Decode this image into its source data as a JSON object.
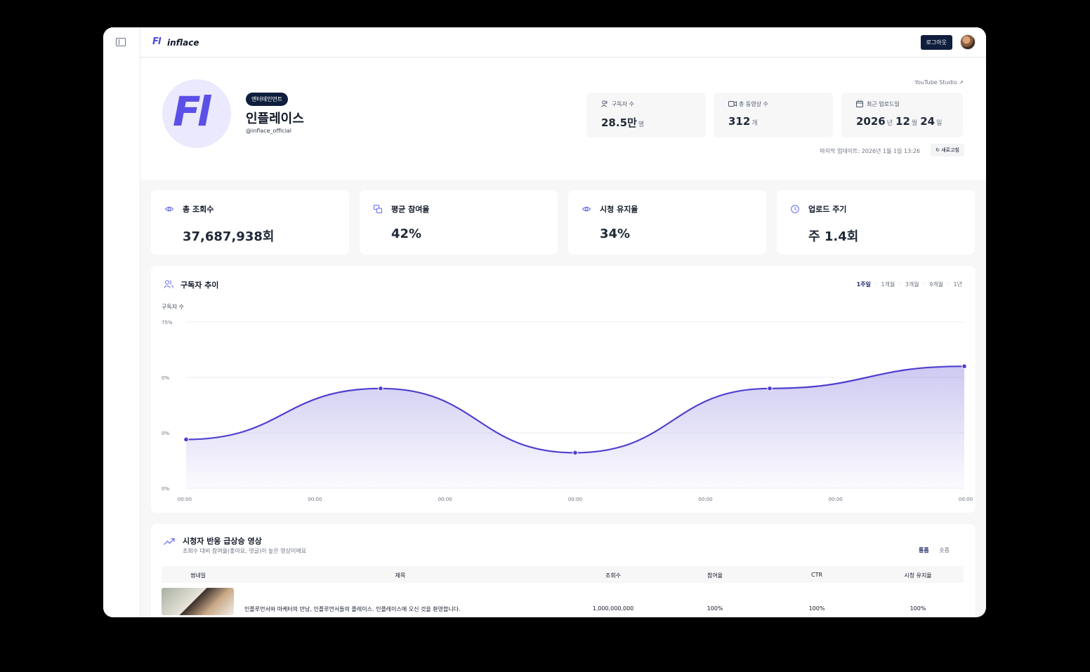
{
  "header": {
    "logo_mark": "Fl",
    "logo_text": "inflace",
    "logout_label": "로그아웃"
  },
  "profile": {
    "logo_mark": "Fl",
    "category": "엔터테인먼트",
    "name": "인플레이스",
    "handle": "@inflace_official",
    "studio_link": "YouTube Studio ↗",
    "stats": {
      "subscribers_label": "구독자 수",
      "subscribers_value": "28.5만",
      "subscribers_unit": "명",
      "videos_label": "총 동영상 수",
      "videos_value": "312",
      "videos_unit": "개",
      "upload_label": "최근 업로드일",
      "upload_year": "2026",
      "upload_year_unit": "년",
      "upload_month": "12",
      "upload_month_unit": "월",
      "upload_day": "24",
      "upload_day_unit": "일"
    },
    "updated_text": "마지막 업데이트: 2026년 1월 1일 13:26",
    "refresh_label": "↻ 새로고침"
  },
  "metrics": [
    {
      "label": "총 조회수",
      "value": "37,687,938회",
      "icon": "eye-icon"
    },
    {
      "label": "평균 참여율",
      "value": "42%",
      "icon": "engagement-icon"
    },
    {
      "label": "시청 유지율",
      "value": "34%",
      "icon": "eye-icon"
    },
    {
      "label": "업로드 주기",
      "value": "주 1.4회",
      "icon": "clock-icon"
    }
  ],
  "chart_section": {
    "title": "구독자 추이",
    "ranges": [
      "1주일",
      "1개월",
      "3개월",
      "9개월",
      "1년"
    ],
    "active_range": "1주일"
  },
  "chart_data": {
    "type": "area",
    "ylabel": "구독자 수",
    "y_tick_labels": [
      "75%",
      "0%",
      "0%",
      "0%"
    ],
    "x_tick_labels": [
      "00:00",
      "00:00",
      "00:00",
      "00:00",
      "00:00",
      "00:00",
      "00:00"
    ],
    "ylim": [
      0,
      75
    ],
    "x": [
      0,
      1.5,
      3,
      4.5,
      6
    ],
    "values": [
      22,
      45,
      16,
      45,
      55
    ],
    "grid": true,
    "color": "#4f3fd0"
  },
  "table_section": {
    "title": "시청자 반응 급상승 영상",
    "subtitle": "조회수 대비 참여율(좋아요, 댓글)이 높은 영상이에요",
    "tabs": [
      "롱폼",
      "숏폼"
    ],
    "active_tab": "롱폼",
    "columns": [
      "썸네일",
      "제목",
      "조회수",
      "참여율",
      "CTR",
      "시청 유지율"
    ],
    "rows": [
      {
        "title": "인플루언서와 마케터의 만남, 인플루언서들의 플레이스. 인플레이스에 오신 것을 환영합니다.",
        "views": "1,000,000,000",
        "engagement": "100%",
        "ctr": "100%",
        "retention": "100%"
      }
    ]
  }
}
